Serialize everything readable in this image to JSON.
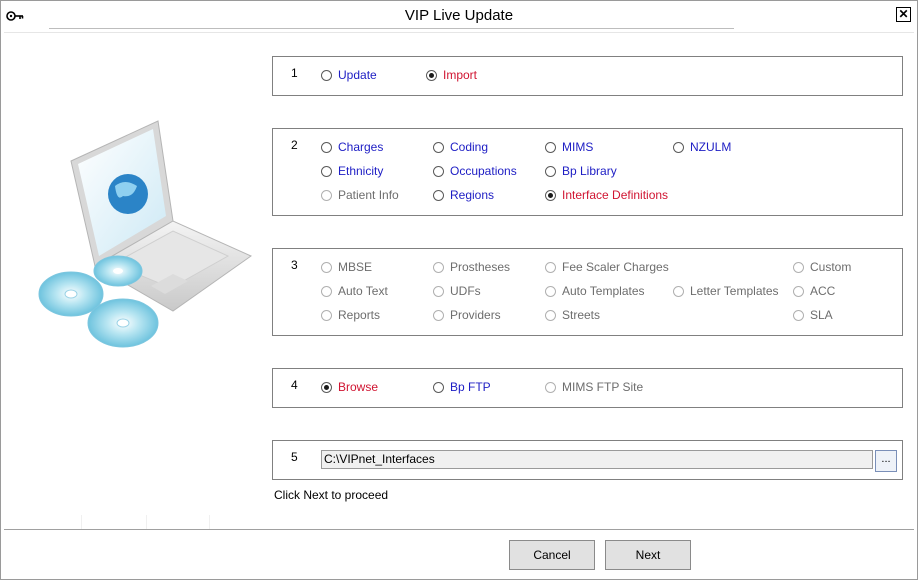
{
  "window": {
    "title": "VIP Live Update"
  },
  "groups": {
    "g1": {
      "number": "1",
      "items": [
        {
          "label": "Update",
          "selected": false,
          "enabled": true,
          "color": "blue"
        },
        {
          "label": "Import",
          "selected": true,
          "enabled": true,
          "color": "red"
        }
      ]
    },
    "g2": {
      "number": "2",
      "items": [
        {
          "label": "Charges",
          "selected": false,
          "enabled": true,
          "color": "blue"
        },
        {
          "label": "Coding",
          "selected": false,
          "enabled": true,
          "color": "blue"
        },
        {
          "label": "MIMS",
          "selected": false,
          "enabled": true,
          "color": "blue"
        },
        {
          "label": "NZULM",
          "selected": false,
          "enabled": true,
          "color": "blue"
        },
        {
          "label": "Ethnicity",
          "selected": false,
          "enabled": true,
          "color": "blue"
        },
        {
          "label": "Occupations",
          "selected": false,
          "enabled": true,
          "color": "blue"
        },
        {
          "label": "Bp Library",
          "selected": false,
          "enabled": true,
          "color": "blue"
        },
        {
          "label": "Patient Info",
          "selected": false,
          "enabled": false,
          "color": "gray"
        },
        {
          "label": "Regions",
          "selected": false,
          "enabled": true,
          "color": "blue"
        },
        {
          "label": "Interface Definitions",
          "selected": true,
          "enabled": true,
          "color": "red"
        }
      ]
    },
    "g3": {
      "number": "3",
      "items": [
        {
          "label": "MBSE"
        },
        {
          "label": "Prostheses"
        },
        {
          "label": "Fee Scaler Charges"
        },
        {
          "label": "Custom"
        },
        {
          "label": "Auto Text"
        },
        {
          "label": "UDFs"
        },
        {
          "label": "Auto Templates"
        },
        {
          "label": "Letter Templates"
        },
        {
          "label": "ACC"
        },
        {
          "label": "Reports"
        },
        {
          "label": "Providers"
        },
        {
          "label": "Streets"
        },
        {
          "label": "SLA"
        }
      ]
    },
    "g4": {
      "number": "4",
      "items": [
        {
          "label": "Browse",
          "selected": true,
          "enabled": true,
          "color": "red"
        },
        {
          "label": "Bp FTP",
          "selected": false,
          "enabled": true,
          "color": "blue"
        },
        {
          "label": "MIMS FTP Site",
          "selected": false,
          "enabled": false,
          "color": "gray"
        }
      ]
    },
    "g5": {
      "number": "5",
      "path_value": "C:\\VIPnet_Interfaces",
      "browse_label": "..."
    }
  },
  "hint": "Click Next to proceed",
  "buttons": {
    "cancel": "Cancel",
    "next": "Next"
  },
  "colors": {
    "blue": "#1d1dc4",
    "red": "#d01431",
    "disabled": "#6d6d6d"
  }
}
